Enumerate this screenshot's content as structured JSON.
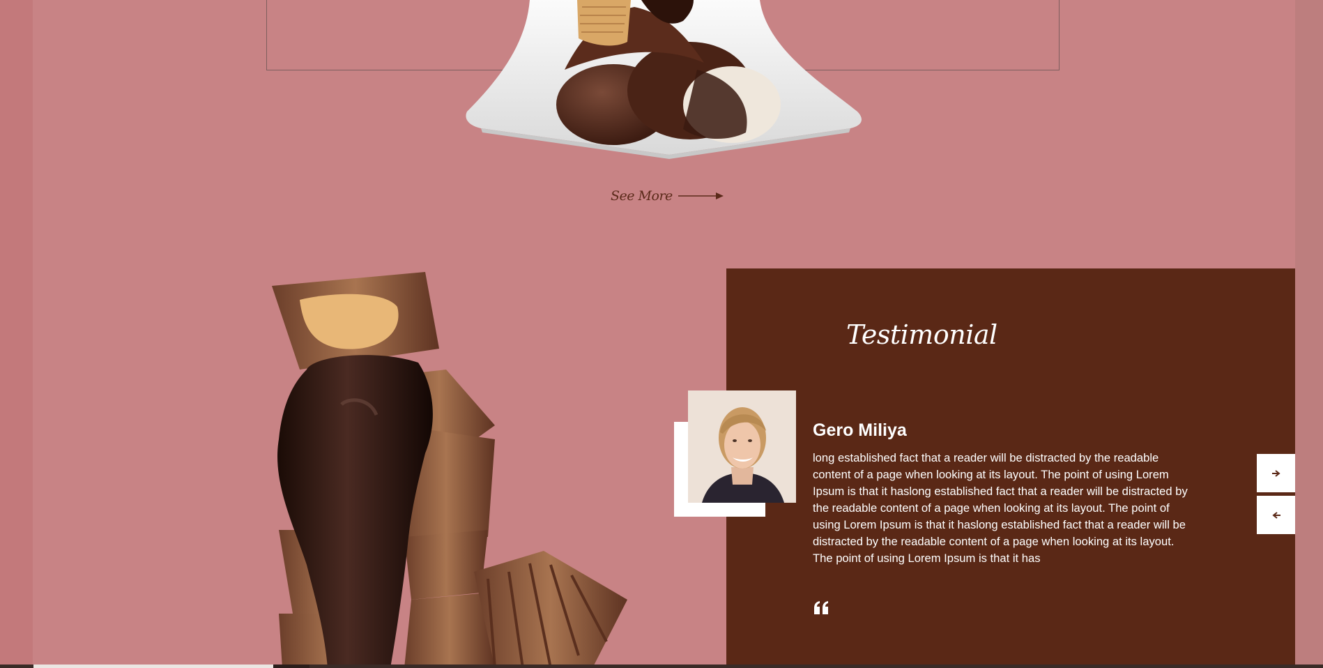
{
  "see_more": {
    "label": "See More"
  },
  "testimonial": {
    "heading": "Testimonial",
    "name": "Gero Miliya",
    "text": "long established fact that a reader will be distracted by the readable content of a page when looking at its layout. The point of using Lorem Ipsum is that it haslong established fact that a reader will be distracted by the readable content of a page when looking at its layout. The point of using Lorem Ipsum is that it haslong established fact that a reader will be distracted by the readable content of a page when looking at its layout. The point of using Lorem Ipsum is that it has"
  },
  "icons": {
    "arrow": "arrow-right-icon",
    "quote": "quote-icon",
    "next": "chevron-right-icon",
    "prev": "chevron-left-icon"
  },
  "colors": {
    "background": "#c88385",
    "panel": "#5a2816",
    "accent": "#5b2a1a",
    "text_on_panel": "#ffffff"
  }
}
